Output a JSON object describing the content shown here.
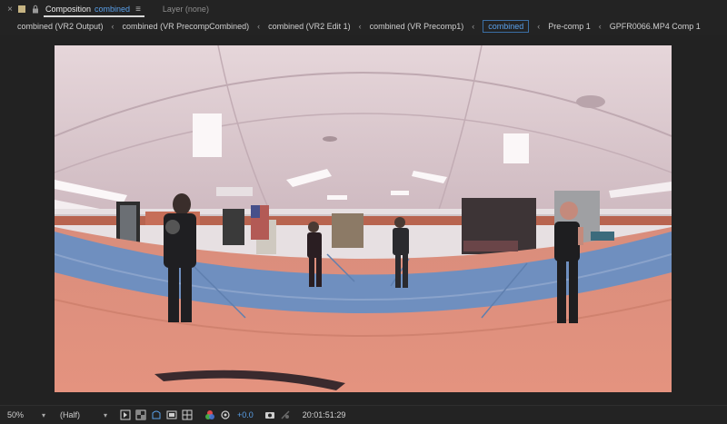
{
  "panel": {
    "close_glyph": "×",
    "composition_label": "Composition",
    "composition_name": "combined",
    "menu_glyph": "≡",
    "layer_tab": "Layer (none)"
  },
  "breadcrumbs": {
    "separator": "‹",
    "items": [
      {
        "label": "combined (VR2 Output)"
      },
      {
        "label": "combined (VR PrecompCombined)"
      },
      {
        "label": "combined (VR2 Edit 1)"
      },
      {
        "label": "combined (VR Precomp1)"
      },
      {
        "label": "combined"
      },
      {
        "label": "Pre-comp 1"
      },
      {
        "label": "GPFR0066.MP4 Comp 1"
      }
    ]
  },
  "viewer": {
    "frame_content": "360 equirectangular preview of a martial arts studio with blue and red mats"
  },
  "footer": {
    "zoom": "50%",
    "resolution": "(Half)",
    "exposure": "+0.0",
    "timecode": "20:01:51:29"
  },
  "colors": {
    "accent_blue": "#5aa0ea",
    "header_swatch": "#c6b483",
    "panel_bg": "#232323",
    "viewer_bg": "#222222"
  }
}
